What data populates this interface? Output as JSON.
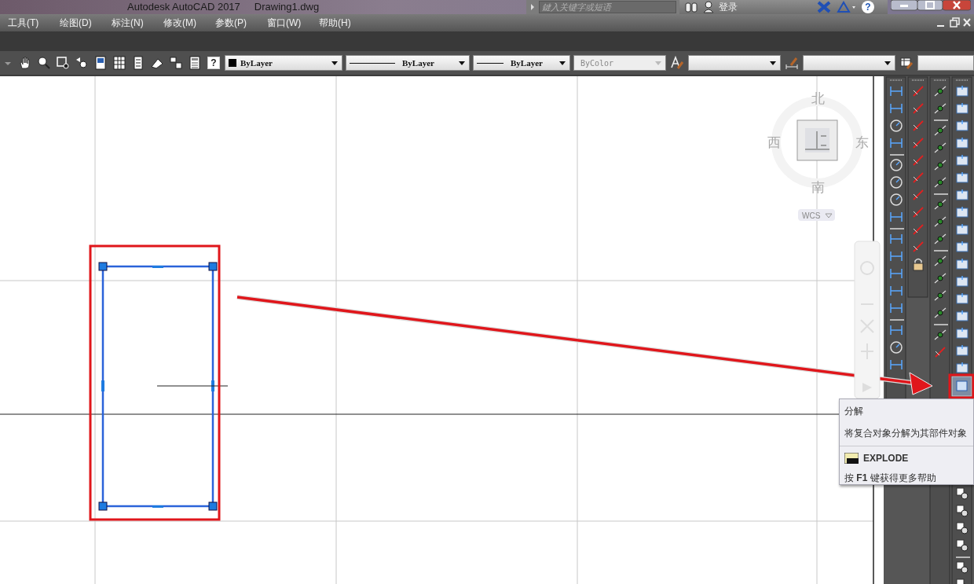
{
  "window": {
    "title": "Autodesk AutoCAD 2017",
    "document": "Drawing1.dwg"
  },
  "search": {
    "placeholder": "鍵入关键字或短语"
  },
  "account": {
    "label": "登录"
  },
  "help_button": "?",
  "menu": [
    {
      "label": "工具(T)"
    },
    {
      "label": "绘图(D)"
    },
    {
      "label": "标注(N)"
    },
    {
      "label": "修改(M)"
    },
    {
      "label": "参数(P)"
    },
    {
      "label": "窗口(W)"
    },
    {
      "label": "帮助(H)"
    }
  ],
  "toolbar": {
    "help_button": "?",
    "combos": [
      {
        "kind": "color",
        "value": "ByLayer",
        "disabled": false
      },
      {
        "kind": "linetype",
        "value": "ByLayer",
        "disabled": false
      },
      {
        "kind": "lineweight",
        "value": "ByLayer",
        "disabled": false
      },
      {
        "kind": "plotstyle",
        "value": "ByColor",
        "disabled": true
      }
    ]
  },
  "viewcube": {
    "north": "北",
    "west": "西",
    "east": "东",
    "south": "南",
    "ucs": "WCS"
  },
  "drawing": {
    "rectangle": {
      "selected": true
    }
  },
  "tooltip": {
    "title": "分解",
    "description": "将复合对象分解为其部件对象",
    "command": "EXPLODE",
    "help": "按 **F1** 键获得更多帮助"
  }
}
